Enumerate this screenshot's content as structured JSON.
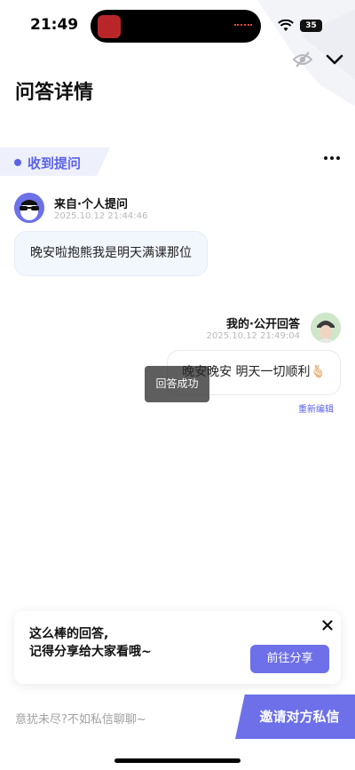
{
  "status_bar": {
    "time": "21:49",
    "battery_level": "35"
  },
  "header": {
    "title": "问答详情"
  },
  "section": {
    "label": "收到提问"
  },
  "question": {
    "from": "来自·个人提问",
    "time": "2025.10.12 21:44:46",
    "text": "晚安啦抱熊我是明天满课那位"
  },
  "answer": {
    "author": "我的·公开回答",
    "time": "2025.10.12 21:49:04",
    "text": "晚安晚安 明天一切顺利🫰🏻",
    "reedit": "重新编辑"
  },
  "toast": {
    "text": "回答成功"
  },
  "share_card": {
    "line1": "这么棒的回答,",
    "line2": "记得分享给大家看哦~",
    "button": "前往分享"
  },
  "bottom_bar": {
    "prompt": "意犹未尽?不如私信聊聊~",
    "invite_button": "邀请对方私信"
  },
  "colors": {
    "accent": "#6d70e8",
    "tag_text": "#5b63e6",
    "bubble_bg": "#f2f6fd"
  },
  "icons": [
    "eye-off-icon",
    "chevron-down-icon",
    "more-icon",
    "close-icon",
    "wifi-icon"
  ]
}
